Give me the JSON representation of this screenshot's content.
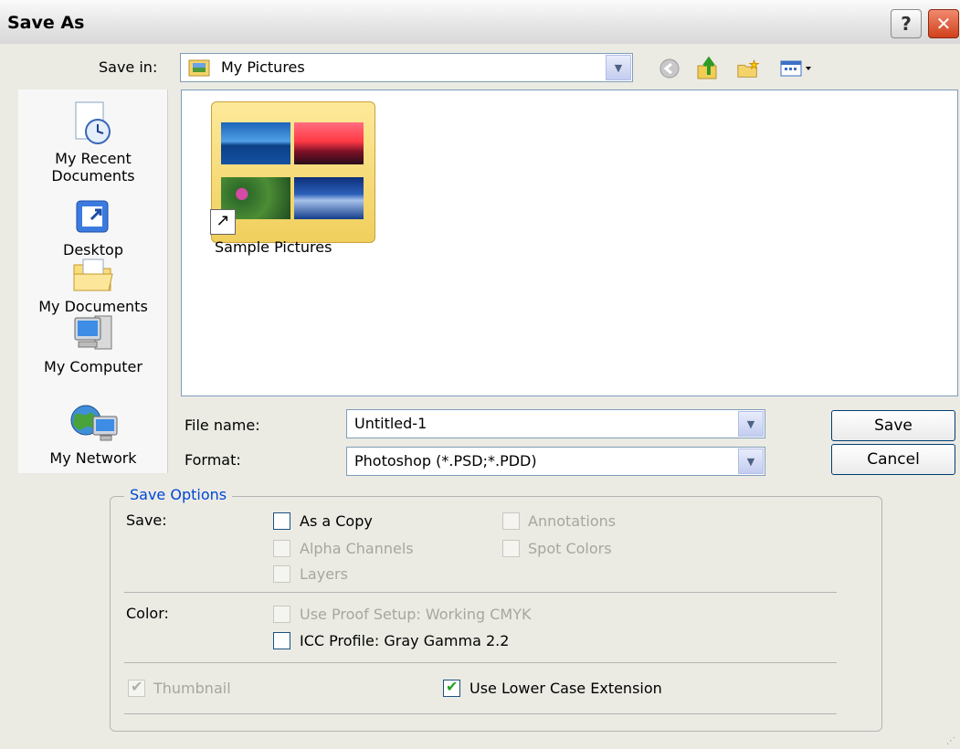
{
  "window": {
    "title": "Save As",
    "help_label": "?",
    "close_label": "✕"
  },
  "save_in": {
    "label": "Save in:",
    "value": "My Pictures"
  },
  "places": [
    {
      "line1": "My Recent",
      "line2": "Documents"
    },
    {
      "line1": "Desktop",
      "line2": ""
    },
    {
      "line1": "My Documents",
      "line2": ""
    },
    {
      "line1": "My Computer",
      "line2": ""
    },
    {
      "line1": "My Network",
      "line2": ""
    }
  ],
  "files": [
    {
      "name": "Sample Pictures"
    }
  ],
  "file_name": {
    "label": "File name:",
    "value": "Untitled-1"
  },
  "format": {
    "label": "Format:",
    "value": "Photoshop (*.PSD;*.PDD)"
  },
  "buttons": {
    "save": "Save",
    "cancel": "Cancel"
  },
  "save_options": {
    "legend": "Save Options",
    "save_label": "Save:",
    "as_a_copy": "As a Copy",
    "annotations": "Annotations",
    "alpha_channels": "Alpha Channels",
    "spot_colors": "Spot Colors",
    "layers": "Layers",
    "color_label": "Color:",
    "use_proof_setup": "Use Proof Setup:  Working CMYK",
    "icc_profile": "ICC Profile:  Gray Gamma 2.2",
    "thumbnail": "Thumbnail",
    "use_lower_case": "Use Lower Case Extension"
  },
  "icons": [
    "help-icon",
    "close-icon",
    "my-pictures-icon",
    "dropdown-arrow-icon",
    "back-icon",
    "up-folder-icon",
    "new-folder-icon",
    "views-menu-icon",
    "recent-documents-icon",
    "desktop-icon",
    "my-documents-icon",
    "my-computer-icon",
    "my-network-icon",
    "folder-icon",
    "shortcut-arrow-icon"
  ],
  "colors": {
    "accent": "#0046d5",
    "dialog_bg": "#ebebe4",
    "close_button": "#d0401c"
  }
}
